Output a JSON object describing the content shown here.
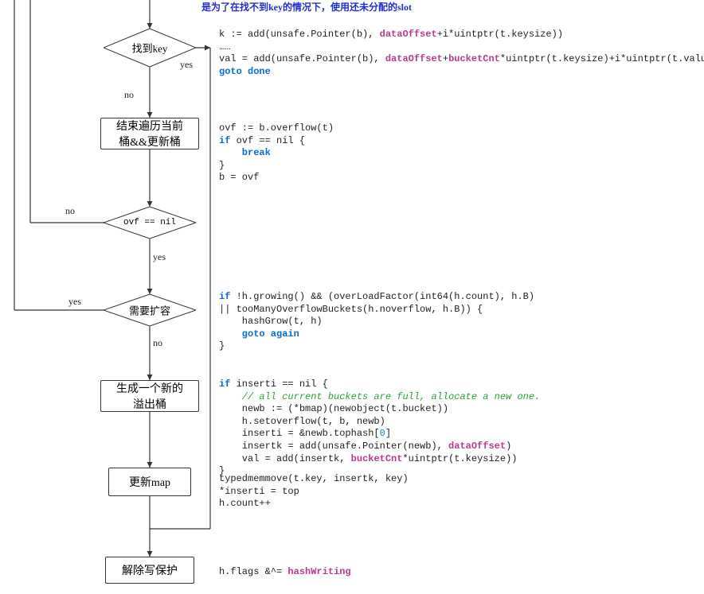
{
  "header_note": "是为了在找不到key的情况下，使用还未分配的slot",
  "flow": {
    "d1": "找到key",
    "d1_yes": "yes",
    "d1_no": "no",
    "b1": "结束遍历当前\n桶&&更新桶",
    "d2": "ovf == nil",
    "d2_no": "no",
    "d2_yes": "yes",
    "d3": "需要扩容",
    "d3_yes": "yes",
    "d3_no": "no",
    "b2": "生成一个新的\n溢出桶",
    "b3": "更新map",
    "b4": "解除写保护"
  },
  "code": {
    "c1_l1a": "k := add(unsafe.Pointer(b), ",
    "c1_l1b": "dataOffset",
    "c1_l1c": "+i*uintptr(t.keysize))",
    "c1_dots": "……",
    "c1_l2a": "val = add(unsafe.Pointer(b), ",
    "c1_l2b": "dataOffset",
    "c1_l2c": "+",
    "c1_l2d": "bucketCnt",
    "c1_l2e": "*uintptr(t.keysize)+i*uintptr(t.valuesize))",
    "c1_l3a": "goto",
    "c1_l3b": " done",
    "c2_l1": "ovf := b.overflow(t)",
    "c2_l2a": "if",
    "c2_l2b": " ovf == nil {",
    "c2_l3a": "    break",
    "c2_l4": "}",
    "c2_l5": "b = ovf",
    "c3_l1a": "if",
    "c3_l1b": " !h.growing() && (overLoadFactor(int64(h.count), h.B)",
    "c3_l2": "|| tooManyOverflowBuckets(h.noverflow, h.B)) {",
    "c3_l3": "    hashGrow(t, h)",
    "c3_l4a": "    goto",
    "c3_l4b": " again",
    "c3_l5": "}",
    "c4_l1a": "if",
    "c4_l1b": " inserti == nil {",
    "c4_l2": "    // all current buckets are full, allocate a new one.",
    "c4_l3": "    newb := (*bmap)(newobject(t.bucket))",
    "c4_l4": "    h.setoverflow(t, b, newb)",
    "c4_l5a": "    inserti = &newb.tophash[",
    "c4_l5b": "0",
    "c4_l5c": "]",
    "c4_l6a": "    insertk = add(unsafe.Pointer(newb), ",
    "c4_l6b": "dataOffset",
    "c4_l6c": ")",
    "c4_l7a": "    val = add(insertk, ",
    "c4_l7b": "bucketCnt",
    "c4_l7c": "*uintptr(t.keysize))",
    "c4_l8": "}",
    "c5_l1": "typedmemmove(t.key, insertk, key)",
    "c5_l2": "*inserti = top",
    "c5_l3": "h.count++",
    "c6_l1a": "h.flags &^= ",
    "c6_l1b": "hashWriting"
  }
}
